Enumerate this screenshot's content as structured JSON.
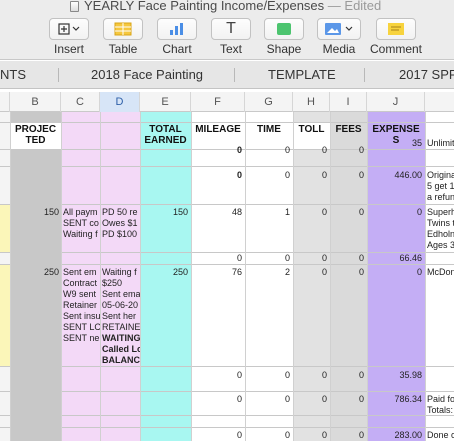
{
  "window": {
    "title": "YEARLY Face Painting Income/Expenses",
    "edited": "— Edited"
  },
  "toolbar": {
    "insert": "Insert",
    "table": "Table",
    "chart": "Chart",
    "text": "Text",
    "shape": "Shape",
    "media": "Media",
    "comment": "Comment",
    "text_glyph": "T"
  },
  "tabs": [
    "NTS",
    "2018 Face Painting",
    "TEMPLATE",
    "2017 SPR"
  ],
  "columns": [
    "B",
    "C",
    "D",
    "E",
    "F",
    "G",
    "H",
    "I",
    "J"
  ],
  "headers": {
    "projected_1": "PROJEC",
    "projected_2": "TED",
    "total_1": "TOTAL",
    "total_2": "EARNED",
    "mileage": "MILEAGE",
    "time": "TIME",
    "toll": "TOLL",
    "fees": "FEES",
    "expenses_1": "EXPENSE",
    "expenses_2": "S"
  },
  "rows": {
    "r0": {
      "f": "0",
      "g": "0",
      "h": "0",
      "i": "0",
      "j": "35",
      "notes": "Unlimit"
    },
    "r1": {
      "f": "0",
      "g": "0",
      "h": "0",
      "i": "0",
      "j": "446.00",
      "notes": [
        "Origina",
        "5 get 1",
        "a refun"
      ]
    },
    "r2": {
      "b": "150",
      "c": [
        "All paym",
        "SENT co",
        "Waiting f"
      ],
      "d": [
        "PD 50 re",
        "Owes $1",
        "PD $100"
      ],
      "e": "150",
      "f": "48",
      "g": "1",
      "h": "0",
      "i": "0",
      "j": "0",
      "notes": [
        "Superh",
        "Twins t",
        "Edholn",
        "Ages 3"
      ]
    },
    "r3": {
      "f": "0",
      "g": "0",
      "h": "0",
      "i": "0",
      "j": "66.46"
    },
    "r4": {
      "b": "250",
      "c": [
        "Sent em",
        "Contract",
        "W9 sent",
        "Retainer",
        "Sent insu",
        "SENT LC",
        "SENT ne"
      ],
      "d": [
        "Waiting f",
        "$250",
        "Sent ema",
        "05-06-20",
        "Sent her",
        "RETAINE",
        "WAITING",
        "Called Lo",
        "BALANC"
      ],
      "e": "250",
      "f": "76",
      "g": "2",
      "h": "0",
      "i": "0",
      "j": "0",
      "notes": "McDon"
    },
    "r5": {
      "f": "0",
      "g": "0",
      "h": "0",
      "i": "0",
      "j": "35.98"
    },
    "r6": {
      "f": "0",
      "g": "0",
      "h": "0",
      "i": "0",
      "j": "786.34",
      "notes": [
        "Paid fo",
        "Totals:"
      ]
    },
    "r7": {
      "f": "0",
      "g": "0",
      "h": "0",
      "i": "0",
      "j": "283.00",
      "notes": "Done c"
    }
  },
  "colors": {
    "lavender": "#f3d9f7",
    "cyan": "#a8f7f1",
    "gray": "#c8c8c8",
    "purple": "#c4aef5",
    "yellow": "#fbf6b9",
    "light_gray": "#dadada"
  }
}
